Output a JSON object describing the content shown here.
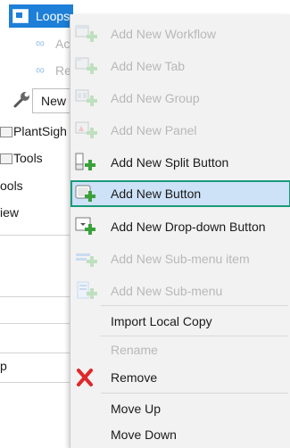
{
  "tree": {
    "selected_label": "Loops",
    "child1_label": "Ac",
    "child2_label": "Re",
    "new_value": "New",
    "node1_label": "PlantSigh",
    "node2_label": "Tools",
    "partial1": "ools",
    "partial2": "iew",
    "partial3": "p"
  },
  "menu": {
    "items": [
      {
        "label": "Add New Workflow",
        "enabled": false,
        "icon": "add-workflow-icon"
      },
      {
        "label": "Add New Tab",
        "enabled": false,
        "icon": "add-tab-icon"
      },
      {
        "label": "Add New Group",
        "enabled": false,
        "icon": "add-group-icon"
      },
      {
        "label": "Add New Panel",
        "enabled": false,
        "icon": "add-panel-icon"
      },
      {
        "label": "Add New Split Button",
        "enabled": true,
        "icon": "add-split-button-icon"
      },
      {
        "label": "Add New Button",
        "enabled": true,
        "icon": "add-button-icon",
        "highlighted": true
      },
      {
        "label": "Add New Drop-down Button",
        "enabled": true,
        "icon": "add-dropdown-button-icon"
      },
      {
        "label": "Add New Sub-menu item",
        "enabled": false,
        "icon": "add-submenu-item-icon"
      },
      {
        "label": "Add New Sub-menu",
        "enabled": false,
        "icon": "add-submenu-icon"
      },
      {
        "label": "Import Local Copy",
        "enabled": true
      },
      {
        "label": "Rename",
        "enabled": false
      },
      {
        "label": "Remove",
        "enabled": true,
        "icon": "remove-x-icon"
      },
      {
        "label": "Move Up",
        "enabled": true
      },
      {
        "label": "Move Down",
        "enabled": true
      }
    ]
  },
  "colors": {
    "selection_blue": "#1e7fd8",
    "hover_fill": "#cde1f7",
    "hover_border": "#1a9a7a",
    "add_green": "#3aa13a",
    "remove_red": "#e0282a"
  }
}
